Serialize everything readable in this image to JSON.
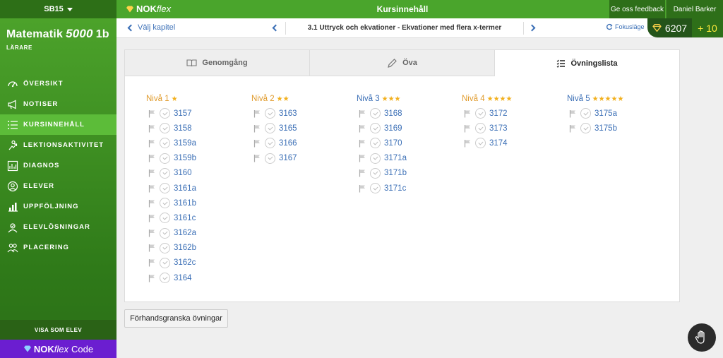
{
  "sidebar": {
    "class_selector": "SB15",
    "course": {
      "title": "Matematik",
      "number": "5000",
      "level": "1b",
      "role": "LÄRARE"
    },
    "items": [
      {
        "label": "ÖVERSIKT",
        "icon": "gauge-icon"
      },
      {
        "label": "NOTISER",
        "icon": "megaphone-icon"
      },
      {
        "label": "KURSINNEHÅLL",
        "icon": "list-icon",
        "active": true
      },
      {
        "label": "LEKTIONSAKTIVITET",
        "icon": "activity-icon"
      },
      {
        "label": "DIAGNOS",
        "icon": "chart-board-icon"
      },
      {
        "label": "ELEVER",
        "icon": "person-icon"
      },
      {
        "label": "UPPFÖLJNING",
        "icon": "bar-chart-icon"
      },
      {
        "label": "ELEVLÖSNINGAR",
        "icon": "solutions-icon"
      },
      {
        "label": "PLACERING",
        "icon": "group-icon"
      }
    ],
    "view_as_student": "VISA SOM ELEV",
    "code_brand": {
      "nok": "NOK",
      "flex": "flex",
      "code": "Code"
    }
  },
  "topbar": {
    "brand_nok": "NOK",
    "brand_flex": "flex",
    "title": "Kursinnehåll",
    "feedback": "Ge oss feedback",
    "user": "Daniel Barker"
  },
  "subbar": {
    "back": "Välj kapitel",
    "section": "3.1 Uttryck och ekvationer - Ekvationer med flera x-termer",
    "focus": "Fokusläge",
    "gems": "6207",
    "plus": "+ 10"
  },
  "tabs": [
    {
      "label": "Genomgång",
      "icon": "book-icon"
    },
    {
      "label": "Öva",
      "icon": "pencil-icon"
    },
    {
      "label": "Övningslista",
      "icon": "checklist-icon",
      "active": true
    }
  ],
  "levels": [
    {
      "label": "Nivå 1",
      "stars": "★",
      "color": "#e09b2d",
      "exercises": [
        "3157",
        "3158",
        "3159a",
        "3159b",
        "3160",
        "3161a",
        "3161b",
        "3161c",
        "3162a",
        "3162b",
        "3162c",
        "3164"
      ]
    },
    {
      "label": "Nivå 2",
      "stars": "★★",
      "color": "#e09b2d",
      "exercises": [
        "3163",
        "3165",
        "3166",
        "3167"
      ]
    },
    {
      "label": "Nivå 3",
      "stars": "★★★",
      "color": "#3b6fb6",
      "exercises": [
        "3168",
        "3169",
        "3170",
        "3171a",
        "3171b",
        "3171c"
      ]
    },
    {
      "label": "Nivå 4",
      "stars": "★★★★",
      "color": "#e09b2d",
      "exercises": [
        "3172",
        "3173",
        "3174"
      ]
    },
    {
      "label": "Nivå 5",
      "stars": "★★★★★",
      "color": "#3b6fb6",
      "exercises": [
        "3175a",
        "3175b"
      ]
    }
  ],
  "preview_button": "Förhandsgranska övningar"
}
